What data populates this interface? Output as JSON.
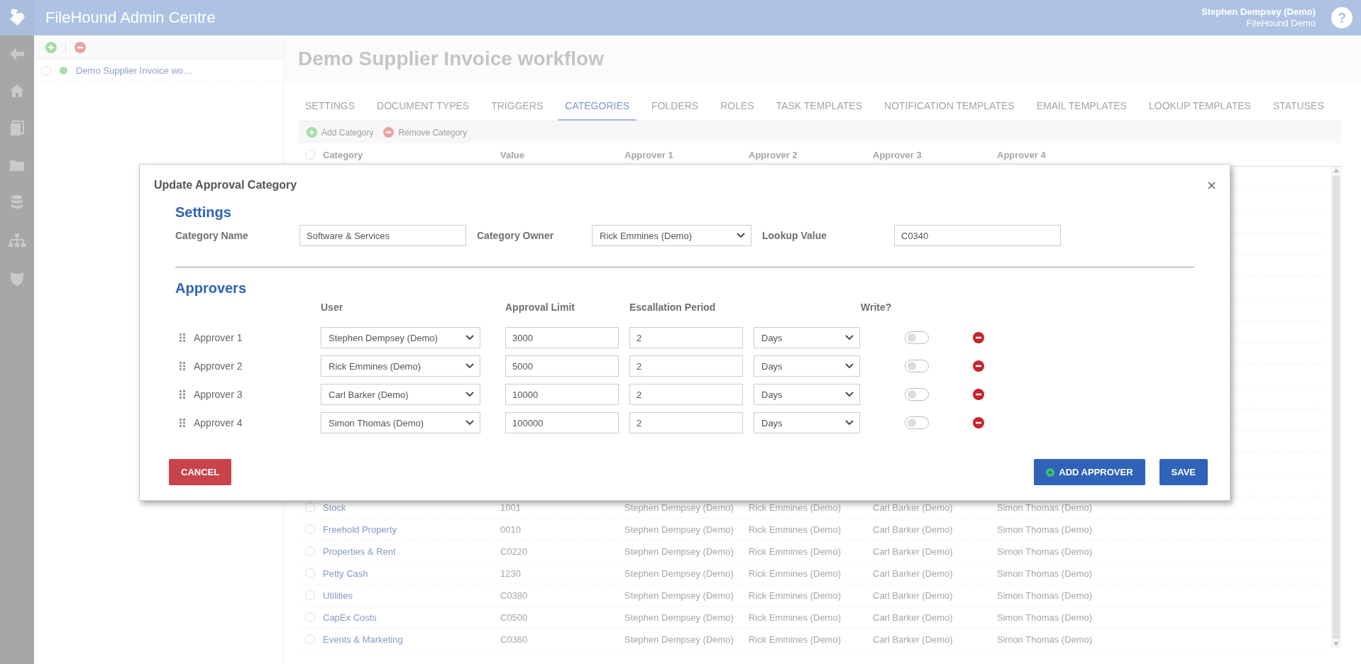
{
  "header": {
    "title": "FileHound Admin Centre",
    "user_name": "Stephen Dempsey (Demo)",
    "org_name": "FileHound Demo",
    "help_label": "?"
  },
  "sidebar": {
    "items": [
      {
        "label": "Demo Supplier Invoice wo…",
        "selected": false
      }
    ]
  },
  "page": {
    "title": "Demo Supplier Invoice workflow",
    "tabs": [
      {
        "label": "SETTINGS",
        "selected": false
      },
      {
        "label": "DOCUMENT TYPES",
        "selected": false
      },
      {
        "label": "TRIGGERS",
        "selected": false
      },
      {
        "label": "CATEGORIES",
        "selected": true
      },
      {
        "label": "FOLDERS",
        "selected": false
      },
      {
        "label": "ROLES",
        "selected": false
      },
      {
        "label": "TASK TEMPLATES",
        "selected": false
      },
      {
        "label": "NOTIFICATION TEMPLATES",
        "selected": false
      },
      {
        "label": "EMAIL TEMPLATES",
        "selected": false
      },
      {
        "label": "LOOKUP TEMPLATES",
        "selected": false
      },
      {
        "label": "STATUSES",
        "selected": false
      }
    ],
    "toolbar": [
      {
        "label": "Add Category",
        "kind": "add"
      },
      {
        "label": "Remove Category",
        "kind": "remove"
      }
    ],
    "table": {
      "all_selected": false,
      "columns": [
        "Category",
        "Value",
        "Approver 1",
        "Approver 2",
        "Approver 3",
        "Approver 4"
      ],
      "rows": [
        {
          "selected": false,
          "cells": [
            "Stock",
            "1001",
            "Stephen Dempsey (Demo)",
            "Rick Emmines (Demo)",
            "Carl Barker (Demo)",
            "Simon Thomas (Demo)"
          ]
        },
        {
          "selected": false,
          "cells": [
            "Freehold Property",
            "0010",
            "Stephen Dempsey (Demo)",
            "Rick Emmines (Demo)",
            "Carl Barker (Demo)",
            "Simon Thomas (Demo)"
          ]
        },
        {
          "selected": false,
          "cells": [
            "Properties & Rent",
            "C0220",
            "Stephen Dempsey (Demo)",
            "Rick Emmines (Demo)",
            "Carl Barker (Demo)",
            "Simon Thomas (Demo)"
          ]
        },
        {
          "selected": false,
          "cells": [
            "Petty Cash",
            "1230",
            "Stephen Dempsey (Demo)",
            "Rick Emmines (Demo)",
            "Carl Barker (Demo)",
            "Simon Thomas (Demo)"
          ]
        },
        {
          "selected": false,
          "cells": [
            "Utilities",
            "C0380",
            "Stephen Dempsey (Demo)",
            "Rick Emmines (Demo)",
            "Carl Barker (Demo)",
            "Simon Thomas (Demo)"
          ]
        },
        {
          "selected": false,
          "cells": [
            "CapEx Costs",
            "C0500",
            "Stephen Dempsey (Demo)",
            "Rick Emmines (Demo)",
            "Carl Barker (Demo)",
            "Simon Thomas (Demo)"
          ]
        },
        {
          "selected": false,
          "cells": [
            "Events & Marketing",
            "C0360",
            "Stephen Dempsey (Demo)",
            "Rick Emmines (Demo)",
            "Carl Barker (Demo)",
            "Simon Thomas (Demo)"
          ]
        }
      ]
    }
  },
  "modal": {
    "title": "Update Approval Category",
    "settings": {
      "heading": "Settings",
      "fields": [
        {
          "label": "Category Name",
          "kind": "text",
          "value": "Software & Services"
        },
        {
          "label": "Category Owner",
          "kind": "select",
          "value": "Rick Emmines (Demo)"
        },
        {
          "label": "Lookup Value",
          "kind": "text",
          "value": "C0340"
        }
      ]
    },
    "approvers": {
      "heading": "Approvers",
      "columns": [
        "User",
        "Approval Limit",
        "Escallation Period",
        "Write?"
      ],
      "rows": [
        {
          "label": "Approver 1",
          "user": "Stephen Dempsey (Demo)",
          "limit": "3000",
          "period": "2",
          "unit": "Days",
          "write": false
        },
        {
          "label": "Approver 2",
          "user": "Rick Emmines (Demo)",
          "limit": "5000",
          "period": "2",
          "unit": "Days",
          "write": false
        },
        {
          "label": "Approver 3",
          "user": "Carl Barker (Demo)",
          "limit": "10000",
          "period": "2",
          "unit": "Days",
          "write": false
        },
        {
          "label": "Approver 4",
          "user": "Simon Thomas (Demo)",
          "limit": "100000",
          "period": "2",
          "unit": "Days",
          "write": false
        }
      ]
    },
    "buttons": [
      {
        "label": "CANCEL",
        "kind": "cancel"
      },
      {
        "label": "ADD APPROVER",
        "kind": "add"
      },
      {
        "label": "SAVE",
        "kind": "save"
      }
    ]
  }
}
